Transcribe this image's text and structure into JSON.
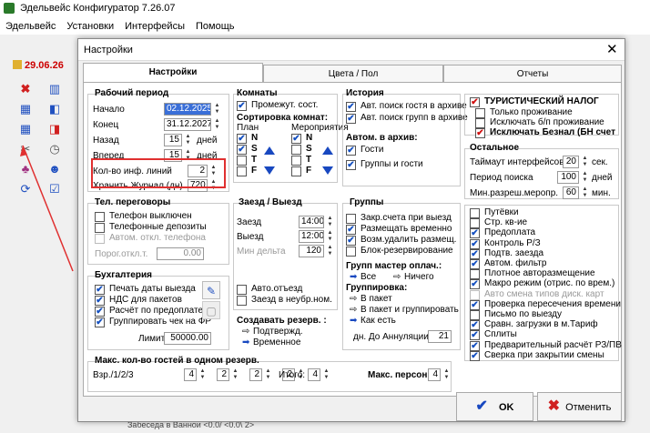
{
  "app": {
    "title": "Эдельвейс Конфигуратор 7.26.07",
    "date_badge": "29.06.26"
  },
  "menu": [
    "Эдельвейс",
    "Установки",
    "Интерфейсы",
    "Помощь"
  ],
  "dialog": {
    "title": "Настройки",
    "tabs": [
      "Настройки",
      "Цвета / Пол",
      "Отчеты"
    ],
    "work_period": {
      "header": "Рабочий период",
      "start_label": "Начало",
      "start_value": "02.12.2025",
      "end_label": "Конец",
      "end_value": "31.12.2027",
      "back_label": "Назад",
      "back_value": "15",
      "back_unit": "дней",
      "fwd_label": "Вперед",
      "fwd_value": "15",
      "fwd_unit": "дней",
      "inf_label": "Кол-во инф. линий",
      "inf_value": "2",
      "journal_label": "Хранить Журнал (дн)",
      "journal_value": "720"
    },
    "phone": {
      "header": "Тел. переговоры",
      "items": [
        "Телефон выключен",
        "Телефонные депозиты",
        "Автом. откл. телефона"
      ],
      "thresh_label": "Порог.откл.т.",
      "thresh_value": "0.00"
    },
    "accounting": {
      "header": "Бухгалтерия",
      "items": [
        "Печать даты выезда",
        "НДС для пакетов",
        "Расчёт по предоплате",
        "Группировать чек на ФР"
      ],
      "limit_label": "Лимит",
      "limit_value": "50000.00"
    },
    "rooms": {
      "header": "Комнаты",
      "interim": "Промежут. сост.",
      "sort_header": "Сортировка комнат:",
      "plan_label": "План",
      "events_label": "Мероприятия",
      "letters": [
        "N",
        "S",
        "T",
        "F"
      ]
    },
    "checkin": {
      "header": "Заезд / Выезд",
      "in_label": "Заезд",
      "in_value": "14:00",
      "out_label": "Выезд",
      "out_value": "12:00",
      "delta_label": "Мин дельта",
      "delta_value": "120",
      "auto_out": "Авто.отъезд",
      "arr_unnum": "Заезд в неубр.ном.",
      "create_header": "Создавать резерв. :",
      "confirmed": "Подтвержд.",
      "temporary": "Временное"
    },
    "history": {
      "header": "История",
      "items": [
        "Авт. поиск гостя в архиве",
        "Авт. поиск групп в архиве"
      ],
      "archive_header": "Автом. в архив:",
      "archive_items": [
        "Гости",
        "Группы и гости"
      ]
    },
    "groups": {
      "header": "Группы",
      "items": [
        "Закр.счета при выезд",
        "Размещать временно",
        "Возм.удалить размещ.",
        "Блок-резервирование"
      ],
      "payer_header": "Групп мастер оплач.:",
      "all": "Все",
      "none": "Ничего",
      "grouping_header": "Группировка:",
      "g_items": [
        "В пакет",
        "В пакет и группировать",
        "Как есть"
      ],
      "ann_label": "дн. До Аннуляции",
      "ann_value": "21"
    },
    "tax": {
      "tourist_tax": "ТУРИСТИЧЕСКИЙ НАЛОГ",
      "items": [
        "Только проживание",
        "Исключать б/п проживание"
      ],
      "exclude": "Исключать Безнал (БН счет"
    },
    "misc": {
      "header": "Остальное",
      "timer_label": "Таймаут интерфейсов",
      "timer_value": "20",
      "timer_unit": "сек.",
      "search_label": "Период поиска",
      "search_value": "100",
      "search_unit": "дней",
      "minres_label": "Мин.разреш.меропр.",
      "minres_value": "60",
      "minres_unit": "мин."
    },
    "options": [
      "Путёвки",
      "Стр. кв-ие",
      "Предоплата",
      "Контроль Р/З",
      "Подтв. заезда",
      "Автом. фильтр",
      "Плотное авторазмещение",
      "Макро режим (отрис. по врем.)",
      "Авто смена типов диск. карт",
      "Проверка пересечения времени",
      "Письмо по выезду",
      "Сравн. загрузки в м.Тариф",
      "Сплиты",
      "Предварительный расчёт РЗ/ПВ",
      "Сверка при закрытии смены"
    ],
    "max_guests": {
      "header": "Макс. кол-во гостей в одном резерв.",
      "age_label": "Взр./1/2/3",
      "values": [
        "4",
        "2",
        "2",
        "2"
      ],
      "total_label": "Итого:",
      "total_value": "4"
    },
    "max_persons": {
      "label": "Макс. персон",
      "value": "4"
    },
    "buttons": {
      "ok": "OK",
      "cancel": "Отменить"
    },
    "bg_text": "Забеседа в Ваннои <0.0/ <0.0\\ 2>"
  }
}
